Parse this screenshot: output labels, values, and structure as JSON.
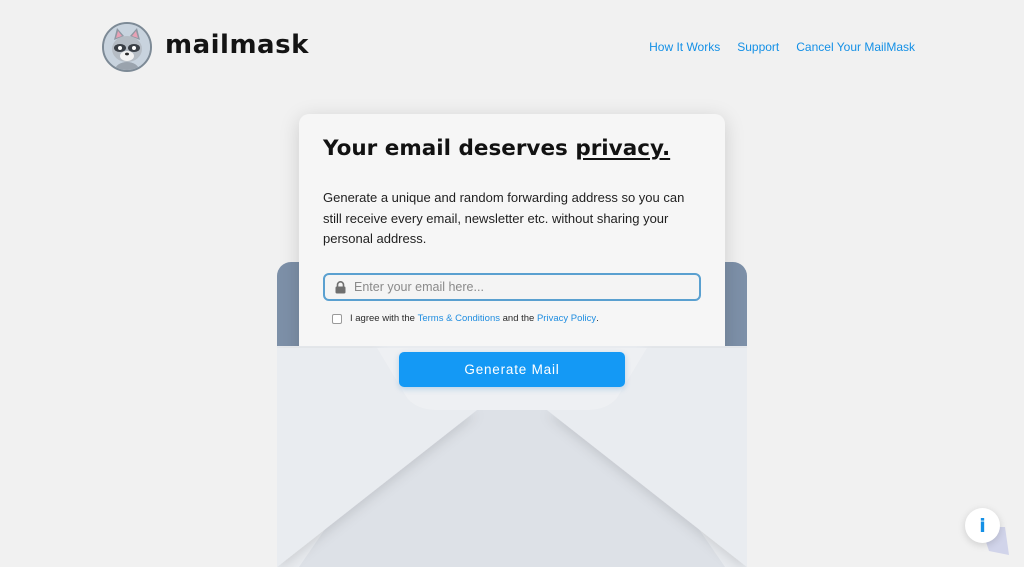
{
  "brand": {
    "name": "mailmask",
    "logo_icon": "raccoon-mascot-icon"
  },
  "nav": {
    "items": [
      {
        "label": "How It Works"
      },
      {
        "label": "Support"
      },
      {
        "label": "Cancel Your MailMask"
      }
    ]
  },
  "hero": {
    "title_prefix": "Your email deserves ",
    "title_emphasis": "privacy.",
    "description": "Generate a unique and random forwarding address so you can still receive every email, newsletter etc. without sharing your personal address."
  },
  "form": {
    "email_placeholder": "Enter your email here...",
    "email_value": "",
    "lock_icon": "lock-icon",
    "agree_prefix": "I agree with the ",
    "terms_link": "Terms & Conditions",
    "agree_middle": " and the ",
    "privacy_link": "Privacy Policy",
    "agree_suffix": ".",
    "agree_checked": false,
    "generate_label": "Generate Mail"
  },
  "help": {
    "info_label": "i"
  },
  "colors": {
    "accent": "#1499f5",
    "link": "#1490e6",
    "background": "#f1f1f1",
    "envelope_back": "#7d90a8",
    "envelope_front": "#e7eaee"
  }
}
